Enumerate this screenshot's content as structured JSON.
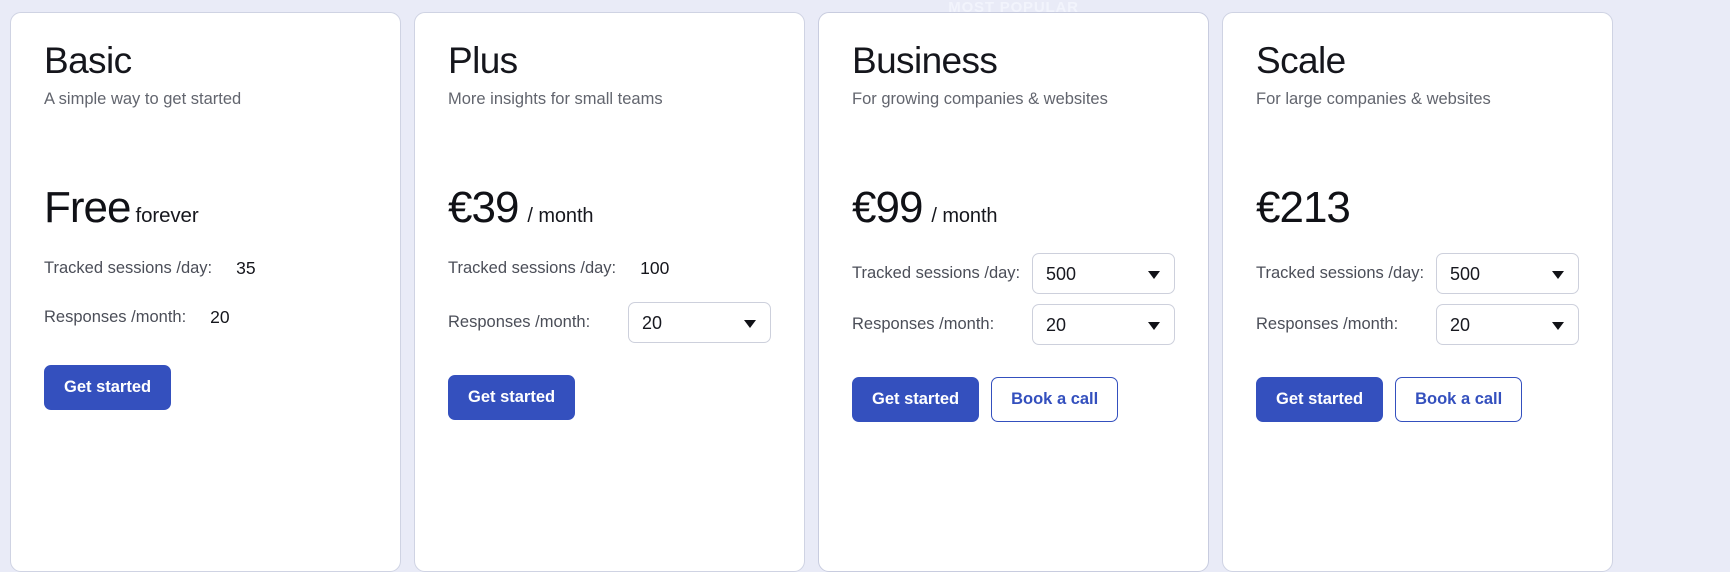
{
  "theme": {
    "page_background": "#e9ebf7",
    "card_background": "#ffffff",
    "card_border": "#cfd3e3",
    "primary_button": "#3450be",
    "heading_color": "#15161c",
    "muted_text": "#62656e"
  },
  "badges": {
    "most_popular": "MOST POPULAR"
  },
  "labels": {
    "tracked_sessions": "Tracked sessions /day:",
    "responses": "Responses /month:",
    "get_started": "Get started",
    "book_a_call": "Book a call"
  },
  "icons": {
    "chevron": "chevron-down-icon"
  },
  "plans": [
    {
      "id": "basic",
      "name": "Basic",
      "tagline": "A simple way to get started",
      "price": "Free",
      "period": "forever",
      "period_style": "tight",
      "featured": false,
      "specs": [
        {
          "label": "Tracked sessions /day:",
          "value": "35",
          "control": "static"
        },
        {
          "label": "Responses /month:",
          "value": "20",
          "control": "static"
        }
      ],
      "buttons": [
        {
          "label": "Get started",
          "style": "primary"
        }
      ]
    },
    {
      "id": "plus",
      "name": "Plus",
      "tagline": "More insights for small teams",
      "price": "€39",
      "period": "/ month",
      "period_style": "normal",
      "featured": false,
      "specs": [
        {
          "label": "Tracked sessions /day:",
          "value": "100",
          "control": "static"
        },
        {
          "label": "Responses /month:",
          "value": "20",
          "control": "select"
        }
      ],
      "buttons": [
        {
          "label": "Get started",
          "style": "primary"
        }
      ]
    },
    {
      "id": "business",
      "name": "Business",
      "tagline": "For growing companies & websites",
      "price": "€99",
      "period": "/ month",
      "period_style": "normal",
      "featured": true,
      "badge": "MOST POPULAR",
      "specs": [
        {
          "label": "Tracked sessions /day:",
          "value": "500",
          "control": "select"
        },
        {
          "label": "Responses /month:",
          "value": "20",
          "control": "select"
        }
      ],
      "buttons": [
        {
          "label": "Get started",
          "style": "primary"
        },
        {
          "label": "Book a call",
          "style": "secondary"
        }
      ]
    },
    {
      "id": "scale",
      "name": "Scale",
      "tagline": "For large companies & websites",
      "price": "€213",
      "period": "",
      "period_style": "normal",
      "featured": false,
      "specs": [
        {
          "label": "Tracked sessions /day:",
          "value": "500",
          "control": "select"
        },
        {
          "label": "Responses /month:",
          "value": "20",
          "control": "select"
        }
      ],
      "buttons": [
        {
          "label": "Get started",
          "style": "primary"
        },
        {
          "label": "Book a call",
          "style": "secondary"
        }
      ]
    }
  ]
}
